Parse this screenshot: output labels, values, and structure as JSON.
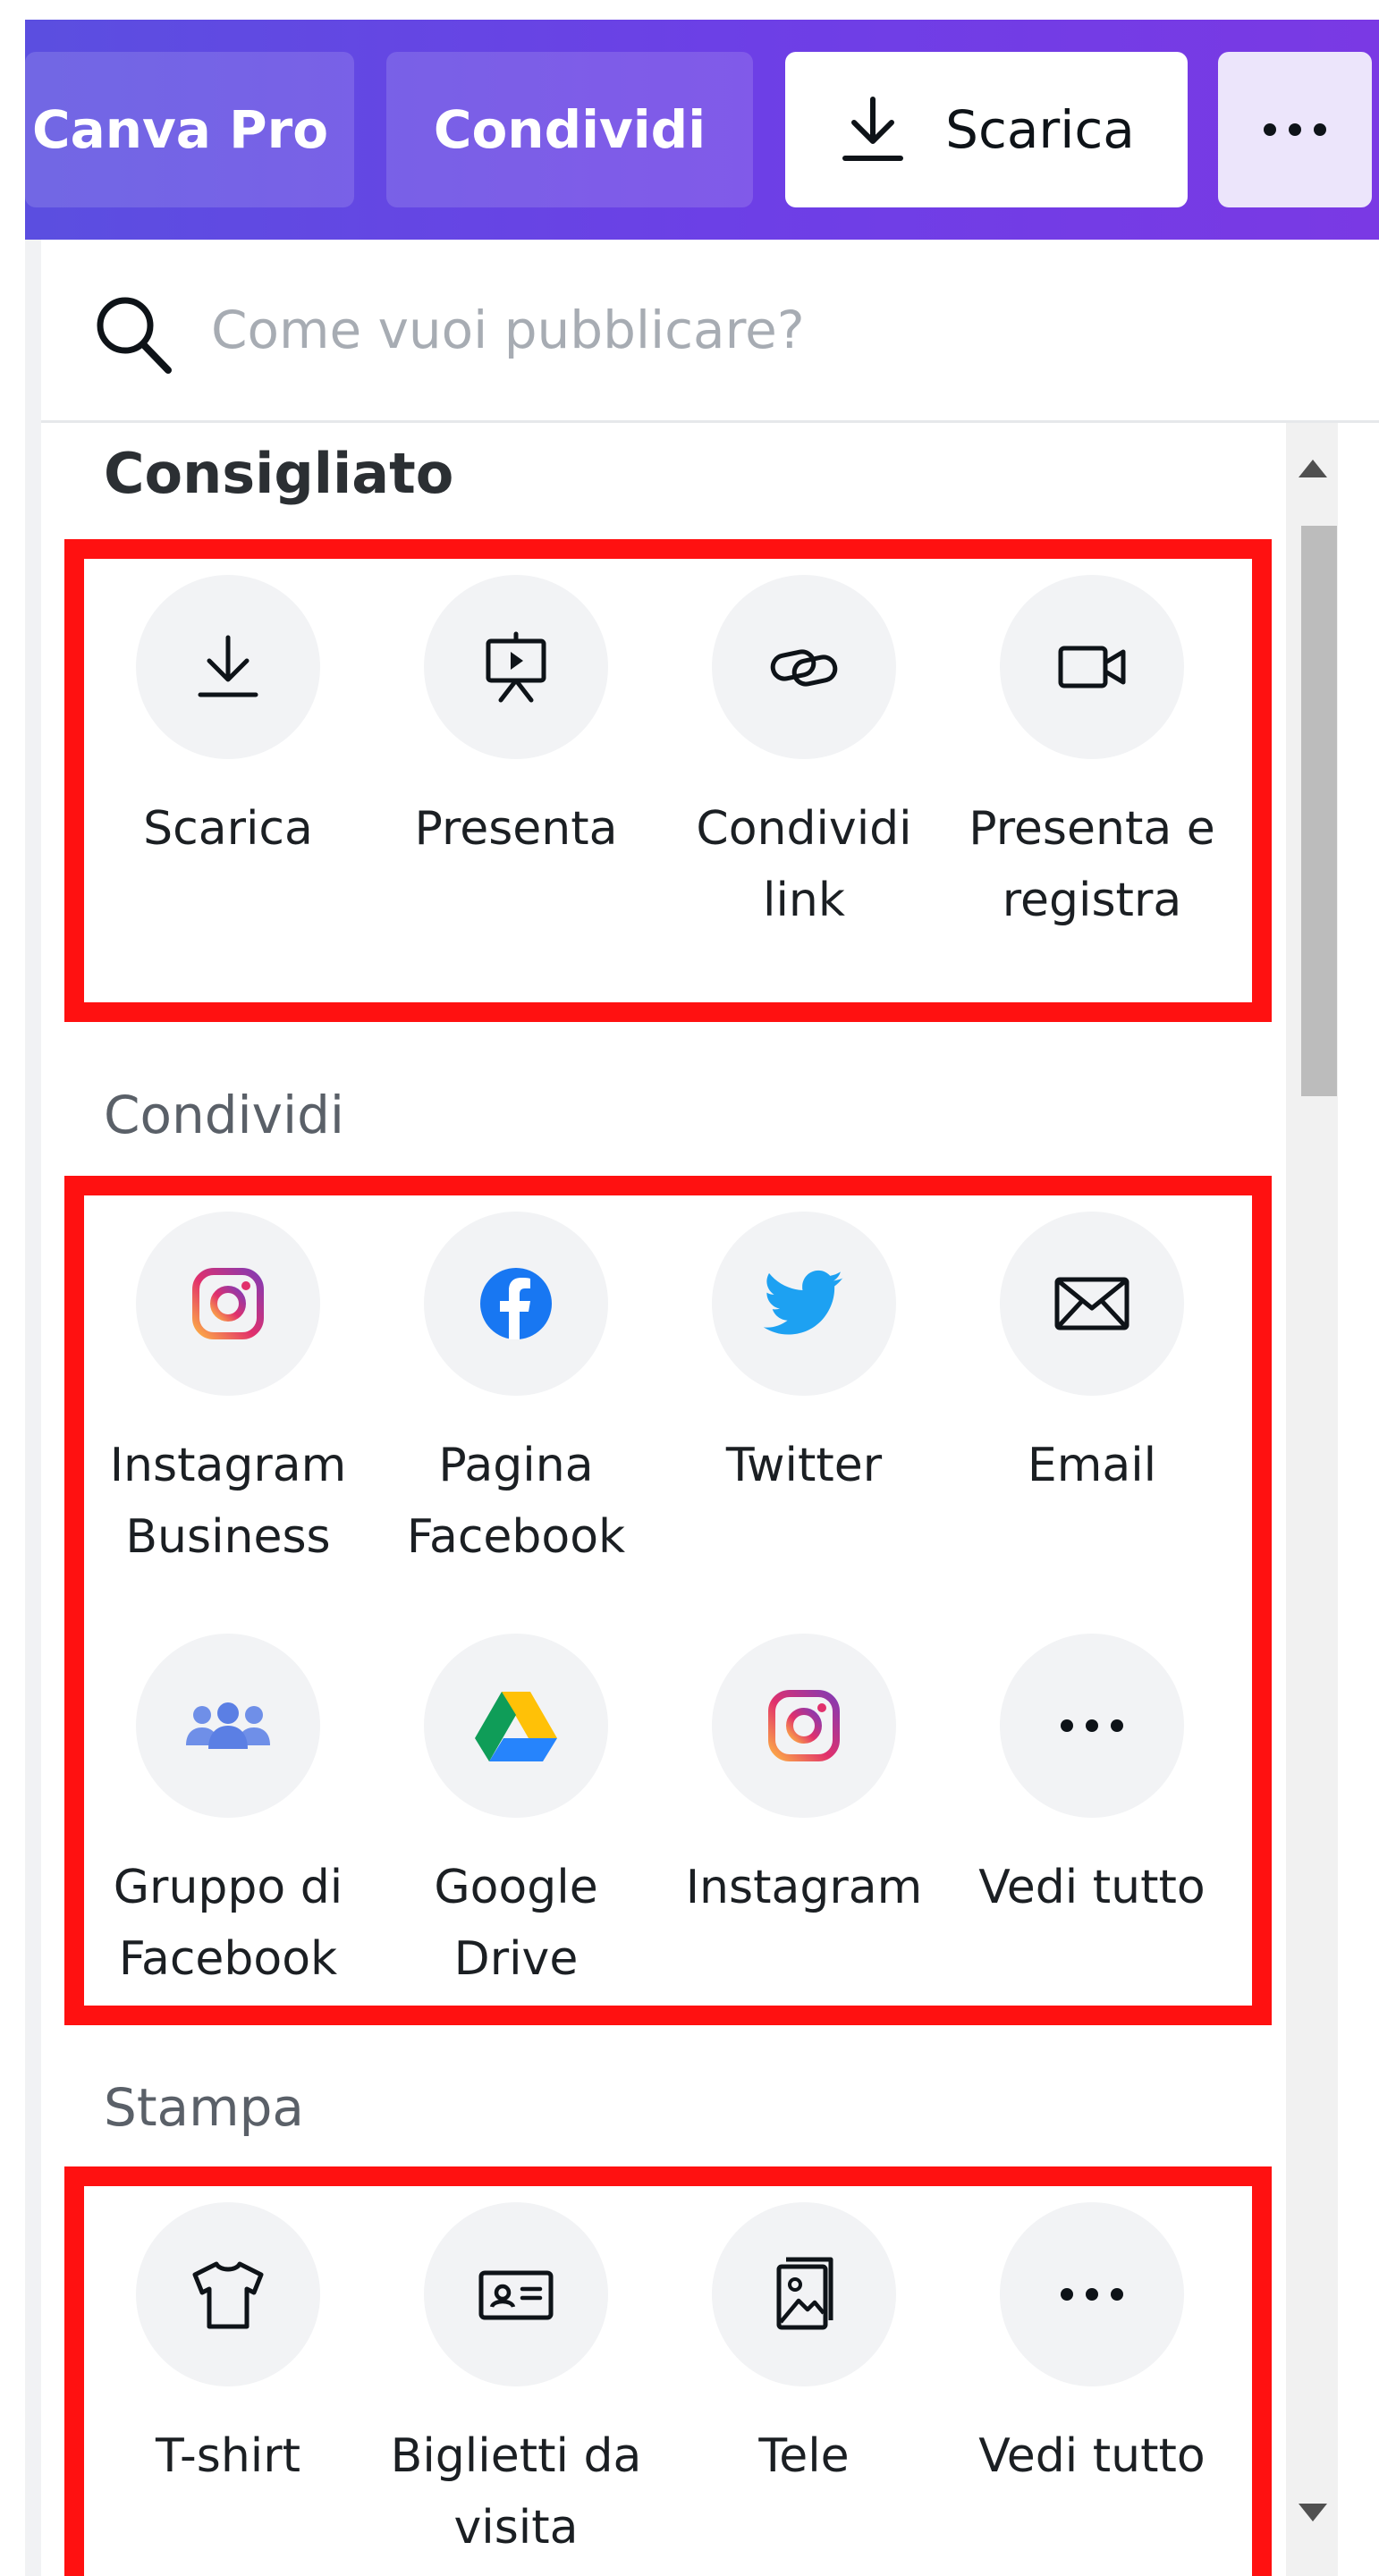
{
  "toolbar": {
    "canva_pro_label": "Canva Pro",
    "share_label": "Condividi",
    "download_label": "Scarica",
    "more_icon": "more-dots-icon"
  },
  "search": {
    "placeholder": "Come vuoi pubblicare?"
  },
  "sections": {
    "recommended": {
      "title": "Consigliato",
      "items": [
        {
          "label_lines": [
            "Scarica"
          ],
          "icon": "download-icon"
        },
        {
          "label_lines": [
            "Presenta"
          ],
          "icon": "presentation-icon"
        },
        {
          "label_lines": [
            "Condividi",
            "link"
          ],
          "icon": "link-icon"
        },
        {
          "label_lines": [
            "Presenta e",
            "registra"
          ],
          "icon": "video-camera-icon"
        }
      ]
    },
    "share": {
      "title": "Condividi",
      "items": [
        {
          "label_lines": [
            "Instagram",
            "Business"
          ],
          "icon": "instagram-icon"
        },
        {
          "label_lines": [
            "Pagina",
            "Facebook"
          ],
          "icon": "facebook-icon"
        },
        {
          "label_lines": [
            "Twitter"
          ],
          "icon": "twitter-icon"
        },
        {
          "label_lines": [
            "Email"
          ],
          "icon": "email-icon"
        },
        {
          "label_lines": [
            "Gruppo di",
            "Facebook"
          ],
          "icon": "facebook-group-icon"
        },
        {
          "label_lines": [
            "Google",
            "Drive"
          ],
          "icon": "google-drive-icon"
        },
        {
          "label_lines": [
            "Instagram"
          ],
          "icon": "instagram-icon"
        },
        {
          "label_lines": [
            "Vedi tutto"
          ],
          "icon": "more-dots-icon"
        }
      ]
    },
    "print": {
      "title": "Stampa",
      "items": [
        {
          "label_lines": [
            "T-shirt"
          ],
          "icon": "tshirt-icon"
        },
        {
          "label_lines": [
            "Biglietti da",
            "visita"
          ],
          "icon": "business-card-icon"
        },
        {
          "label_lines": [
            "Tele"
          ],
          "icon": "canvas-print-icon"
        },
        {
          "label_lines": [
            "Vedi tutto"
          ],
          "icon": "more-dots-icon"
        }
      ]
    }
  },
  "colors": {
    "toolbar_gradient_start": "#5a4fe0",
    "toolbar_gradient_end": "#7a39e4",
    "highlight_border": "#ff1111",
    "tile_background": "#f2f3f5",
    "instagram": "#e1306c",
    "facebook": "#1877f2",
    "twitter": "#1da1f2",
    "facebook_group": "#6f8fe8"
  }
}
